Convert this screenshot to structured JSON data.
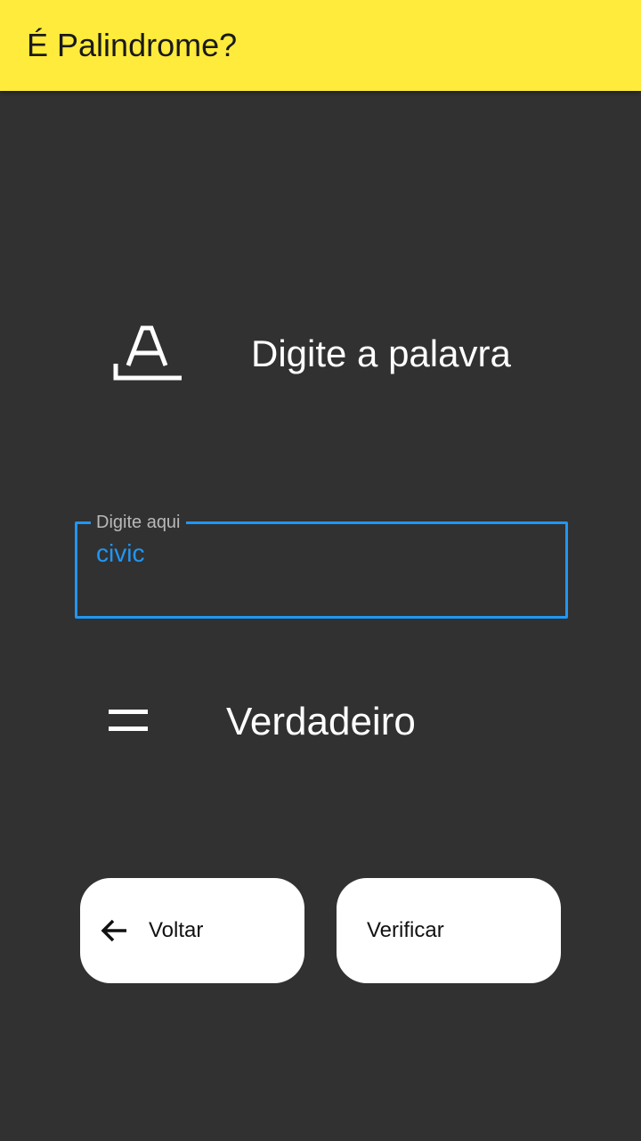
{
  "app_bar": {
    "title": "É Palindrome?",
    "background_color": "#ffeb3b"
  },
  "prompt": {
    "icon": "text-format-icon",
    "label": "Digite a palavra"
  },
  "input": {
    "label": "Digite aqui",
    "value": "civic",
    "accent_color": "#2196f3"
  },
  "result": {
    "icon": "equals-icon",
    "text": "Verdadeiro"
  },
  "buttons": {
    "back": {
      "label": "Voltar",
      "icon": "arrow-back-icon"
    },
    "verify": {
      "label": "Verificar"
    }
  },
  "colors": {
    "background": "#313131",
    "button_background": "#ffffff"
  }
}
